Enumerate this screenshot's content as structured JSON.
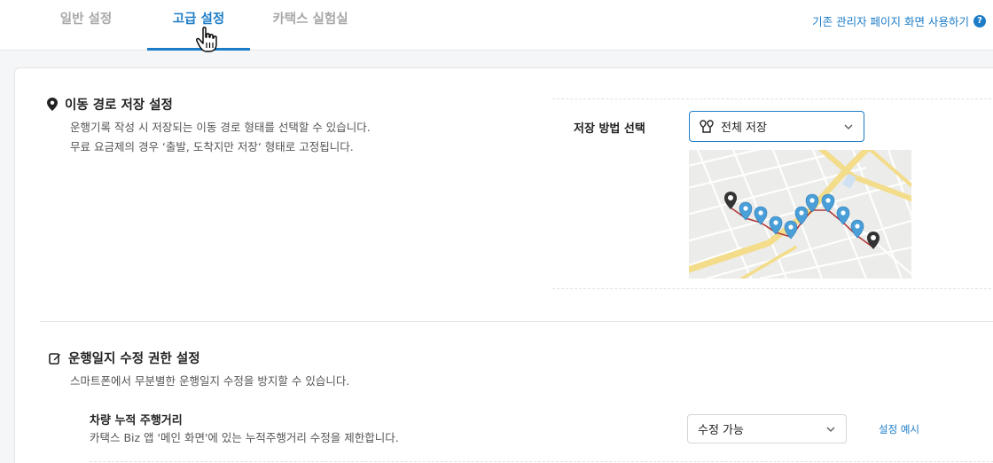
{
  "tabs": [
    {
      "label": "일반 설정",
      "active": false
    },
    {
      "label": "고급 설정",
      "active": true
    },
    {
      "label": "카택스 실험실",
      "active": false
    }
  ],
  "legacy_link": {
    "label": "기존 관리자 페이지 화면 사용하기",
    "help_icon": "?"
  },
  "route_section": {
    "title": "이동 경로 저장 설정",
    "icon": "map-pin-icon",
    "desc_line1": "운행기록 작성 시 저장되는 이동 경로 형태를 선택할 수 있습니다.",
    "desc_line2": "무료 요금제의 경우 ‘출발, 도착지만 저장‘ 형태로 고정됩니다.",
    "field_label": "저장 방법 선택",
    "select_value": "전체 저장",
    "select_icon": "route-pins-icon"
  },
  "permission_section": {
    "title": "운행일지 수정 권한 설정",
    "icon": "edit-icon",
    "desc": "스마트폰에서 무분별한 운행일지 수정을 방지할 수 있습니다.",
    "item_title": "차량 누적 주행거리",
    "item_desc": "카택스 Biz 앱 '메인 화면'에 있는 누적주행거리 수정을 제한합니다.",
    "select_value": "수정 가능",
    "example_link": "설정 예시"
  },
  "colors": {
    "accent": "#1c7cc7",
    "route_line": "#b03a3a",
    "pin_blue": "#4a9fd8",
    "pin_dark": "#333333",
    "map_road": "#f3dc8a"
  }
}
